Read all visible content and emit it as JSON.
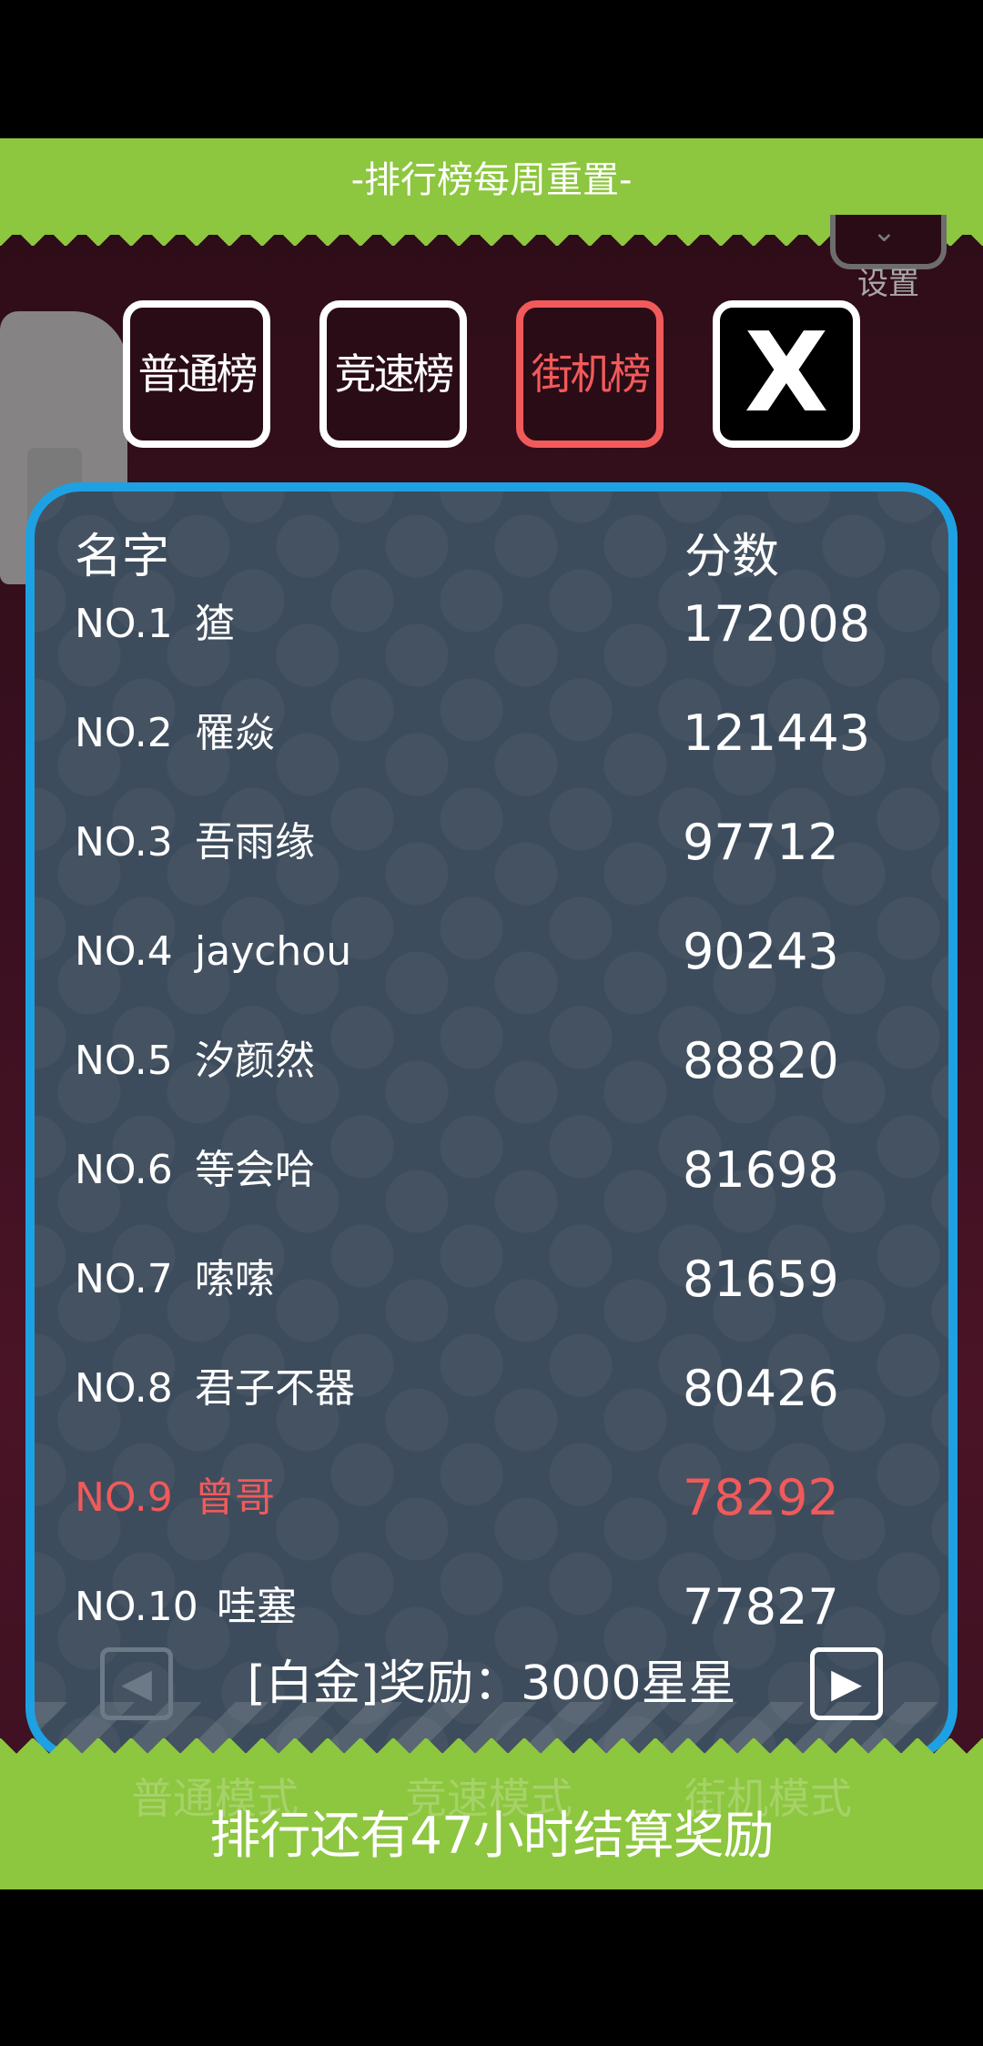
{
  "banner": {
    "title": "-排行榜每周重置-"
  },
  "settings": {
    "label": "设置",
    "icon": "gear-icon"
  },
  "tabs": [
    {
      "label": "普通榜",
      "active": false
    },
    {
      "label": "竞速榜",
      "active": false
    },
    {
      "label": "街机榜",
      "active": true
    }
  ],
  "close": {
    "label": "X",
    "icon": "close-icon"
  },
  "leaderboard": {
    "headers": {
      "name": "名字",
      "score": "分数"
    },
    "rows": [
      {
        "rank": "NO.1",
        "name": "猹",
        "score": "172008"
      },
      {
        "rank": "NO.2",
        "name": "罹焱",
        "score": "121443"
      },
      {
        "rank": "NO.3",
        "name": "吾雨缘",
        "score": "97712"
      },
      {
        "rank": "NO.4",
        "name": "jaychou",
        "score": "90243"
      },
      {
        "rank": "NO.5",
        "name": "汐颜然",
        "score": "88820"
      },
      {
        "rank": "NO.6",
        "name": "等会哈",
        "score": "81698"
      },
      {
        "rank": "NO.7",
        "name": "嗦嗦",
        "score": "81659"
      },
      {
        "rank": "NO.8",
        "name": "君子不器",
        "score": "80426"
      },
      {
        "rank": "NO.9",
        "name": "曾哥",
        "score": "78292",
        "highlight": true
      },
      {
        "rank": "NO.10",
        "name": "哇塞",
        "score": "77827"
      }
    ]
  },
  "reward": {
    "text": "[白金]奖励：3000星星",
    "prev_icon": "arrow-left-icon",
    "next_icon": "arrow-right-icon"
  },
  "footer": {
    "countdown": "排行还有47小时结算奖励",
    "background_modes": [
      "普通模式",
      "竞速模式",
      "街机模式"
    ]
  },
  "colors": {
    "accent_green": "#8dc63f",
    "panel_border": "#1ea1e3",
    "highlight_red": "#f15a5a",
    "panel_bg": "#3d4c5c"
  }
}
